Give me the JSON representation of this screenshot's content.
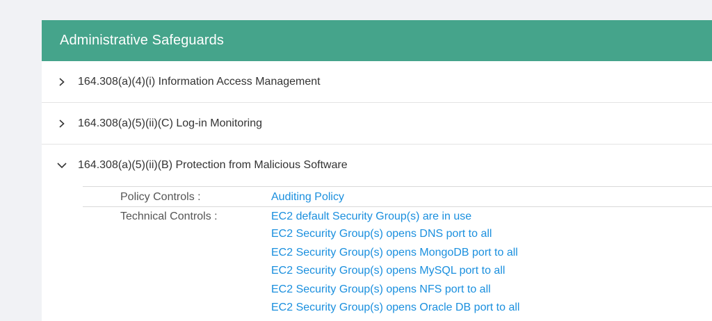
{
  "panel": {
    "title": "Administrative Safeguards"
  },
  "sections": [
    {
      "label": "164.308(a)(4)(i) Information Access Management",
      "expanded": false
    },
    {
      "label": "164.308(a)(5)(ii)(C) Log-in Monitoring",
      "expanded": false
    },
    {
      "label": "164.308(a)(5)(ii)(B) Protection from Malicious Software",
      "expanded": true
    }
  ],
  "details": {
    "policy_label": "Policy Controls :",
    "policy_links": [
      "Auditing Policy"
    ],
    "technical_label": "Technical Controls :",
    "technical_links": [
      "EC2 default Security Group(s) are in use",
      "EC2 Security Group(s) opens DNS port to all",
      "EC2 Security Group(s) opens MongoDB port to all",
      "EC2 Security Group(s) opens MySQL port to all",
      "EC2 Security Group(s) opens NFS port to all",
      "EC2 Security Group(s) opens Oracle DB port to all"
    ]
  },
  "icons": {
    "collapsed": "chevron-right-icon",
    "expanded": "chevron-down-icon"
  },
  "colors": {
    "header": "#45a48b",
    "link": "#1a8fde",
    "background": "#f1f2f5"
  }
}
